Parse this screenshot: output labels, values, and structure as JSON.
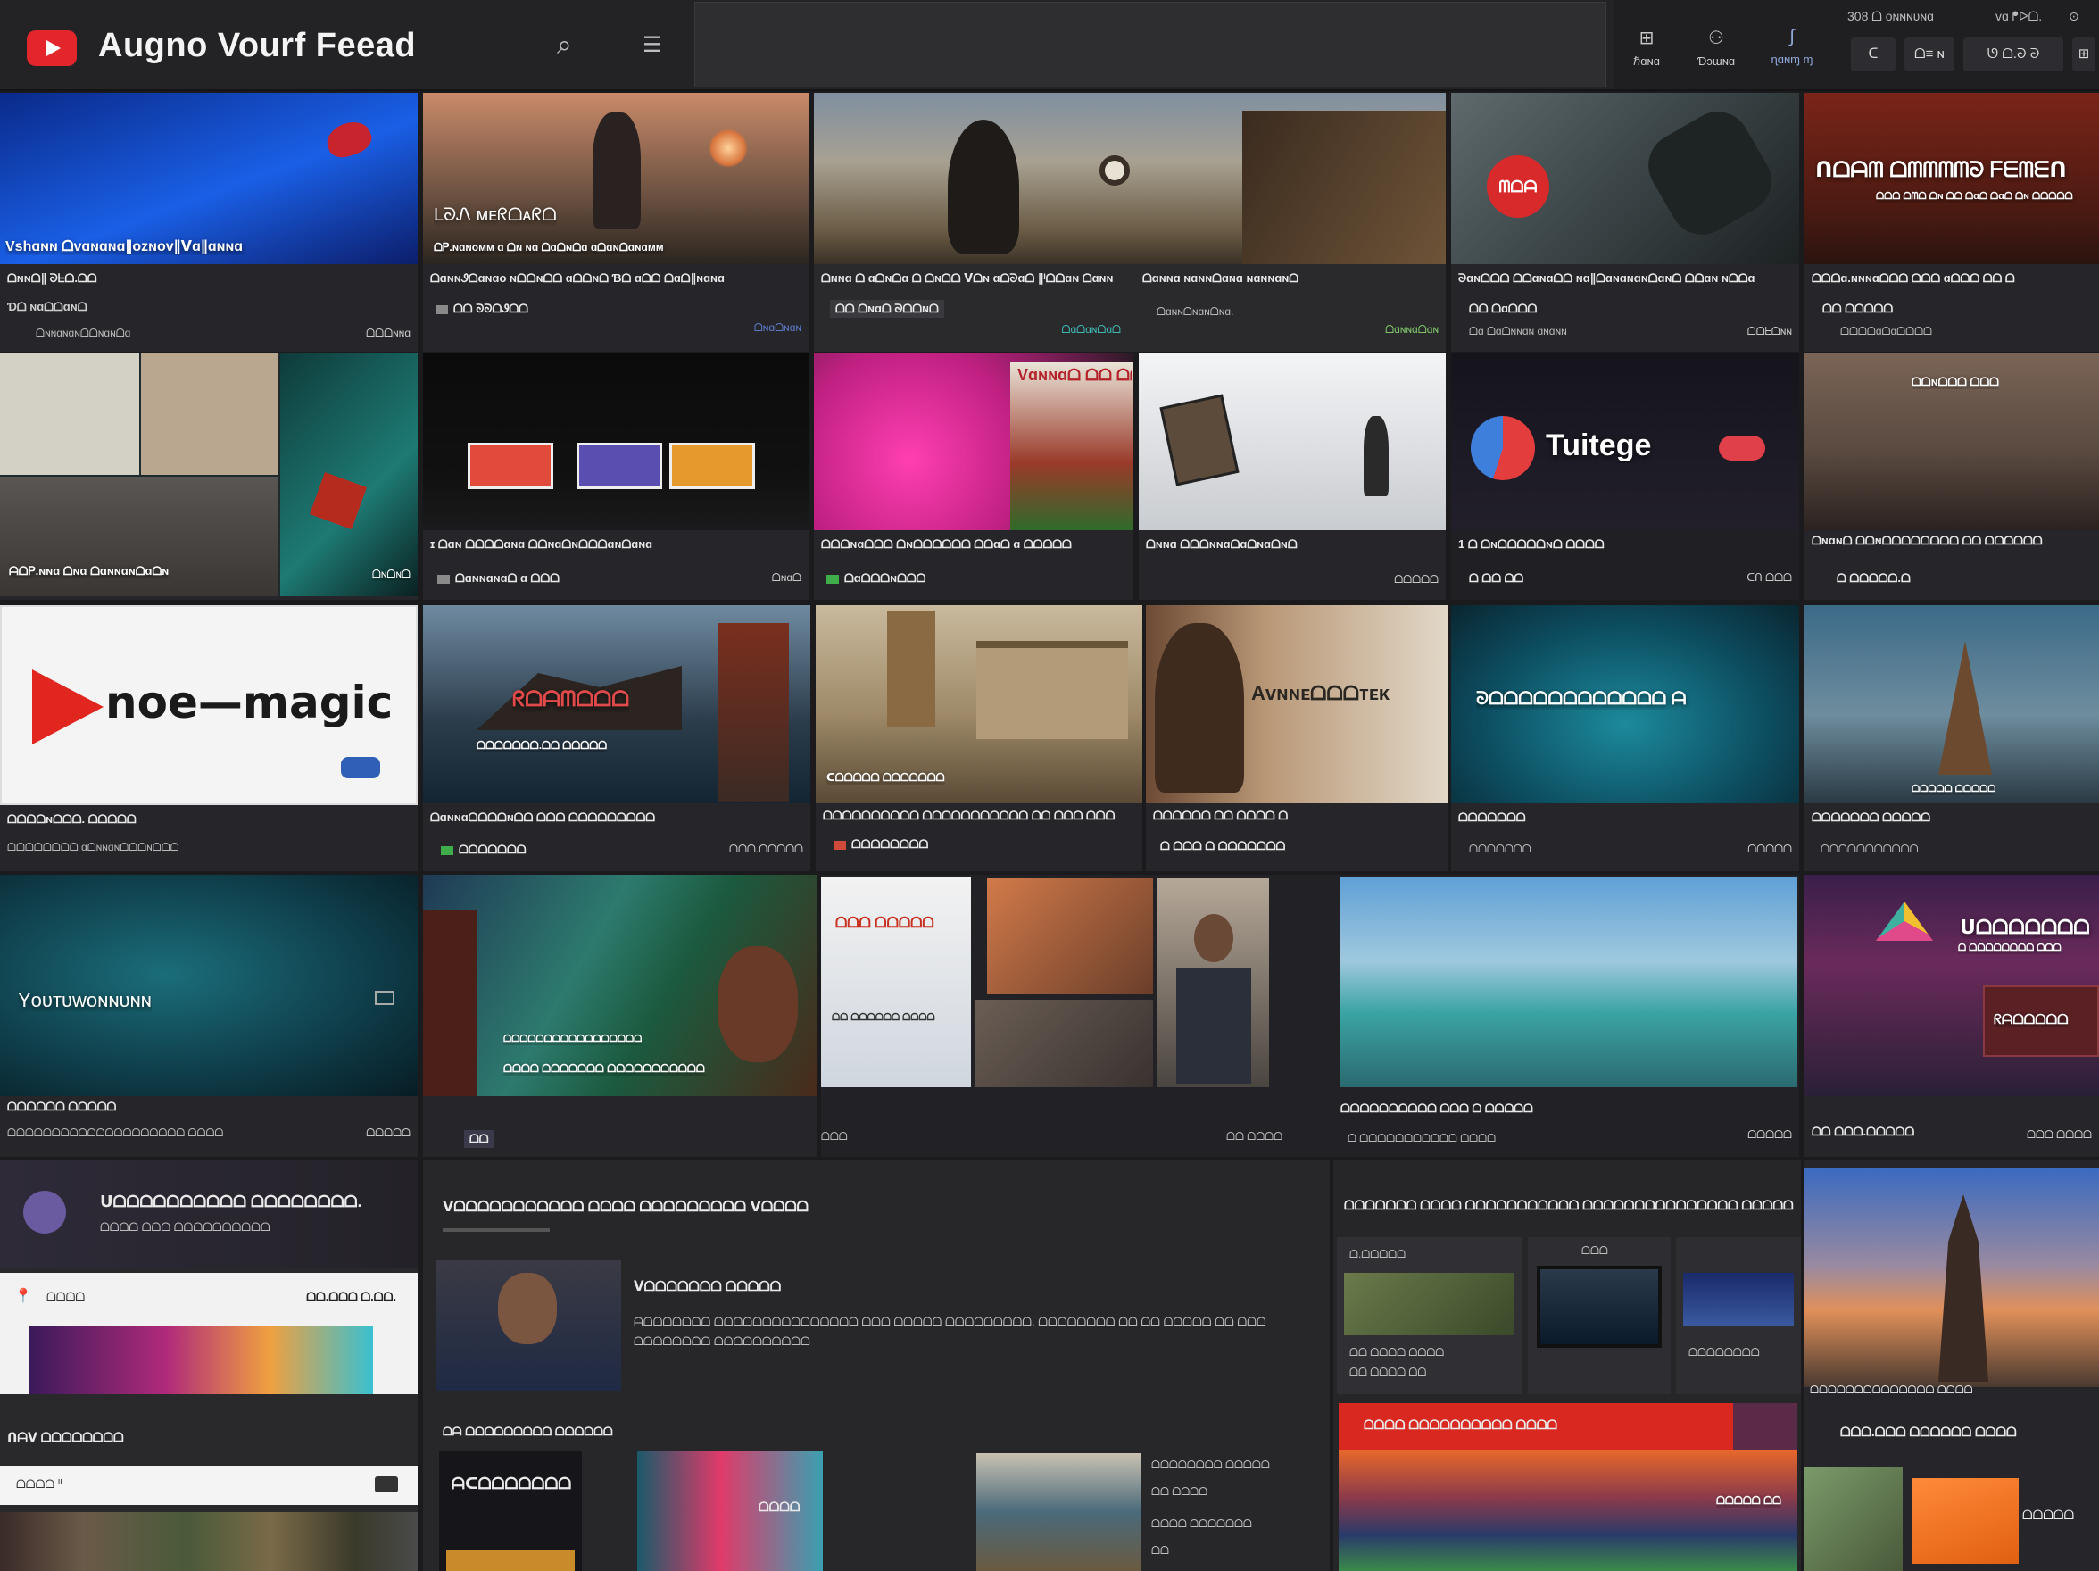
{
  "app": {
    "title": "Augno Vourf Feead"
  },
  "header": {
    "search_button": "ᕕA",
    "right_items": [
      {
        "glyph": "⊞",
        "label": "ℏɑɴɑ"
      },
      {
        "glyph": "⚇",
        "label": "Ɗɔɯɴɑ"
      },
      {
        "glyph": "∫",
        "label": "ɳɑɴɱ ɱ"
      }
    ],
    "stats": [
      "308 ᗝ ᴏɴɴɴʋɴɑ",
      "ᴠɑ ᖰᐅᗝ.",
      "⊙"
    ],
    "chips": [
      "ᑕ",
      "ᗝ≡ ɴ",
      "ᘎ ᗝ.ᘐ ᘐ",
      "⊞"
    ]
  },
  "row1": [
    {
      "title": "Vshɑɴɴ ᗝᴠɑɴɑɴɑ∥ᴏᴢɴᴏᴠ∥ᐯɑ∥ɑɴɴɑ",
      "line1": "ᗝɴɴᗝ∥ ᘐᖶᗝ.ᗝᗝ",
      "line2": "Ɗᗝ ɴɑᗝᗝɑɴᗝ",
      "line3": "ᗝɴɴɑɴɑɴᗝᗝɴɑɴᗝɑ",
      "right": "ᗝᗝᗝɴɴɑ"
    },
    {
      "title": "LᘐᏁ ᴍᴇᖇᗝᴀᖇᗝ",
      "caption": "ᗝᏢ.ɴɑɴᴏᴍᴍ ɑ ᗝɴ ɴɑ ᗝɑᗝɴᗝɑ ɑᗝɑɴᗝɑɴɑᴍᴍ",
      "line1": "ᗝɑɴɴᏭᗝɑɴɑᴏ ɴᗝᗝɴᗝᗝ ɑᗝᗝɴᗝ Ɓᗝ ɑᗝᗝ ᗝɑᗝ∥ɴɑɴɑ",
      "line2": "ᗝᗝ ᘐᘐᗝᏭᗝᗝ",
      "right": "ᗝɴɑᗝɴɑɴ"
    },
    {
      "line1": "ᗝɴɴɑ ᗝ ɑᗝɴᗝɑ ᗝ ᗝɴᗝᗝ ᐯᗝɴ ɑᗝᘐɑᗝ ∥ᴵᗝᗝɑɴ ᗝɑɴɴ",
      "line2": "ᗝᗝ ᗝɴɑᗝ ᘐᗝᗝɴᗝ",
      "right": "ᗝɑᗝɑɴᗝɑᗝ"
    },
    {
      "line1": "ᗝɑɴɴɑ ɴɑɴɴᗝɑɴɑ ɴɑɴɴɑɴᗝ",
      "line2": "ᗝɑɴɴᗝɴɑɴᗝɴɑ.",
      "right": "ᗝɑɴɴɑᗝɑɴ"
    },
    {
      "badge": "ᗰᗝᗩ",
      "line1": "ᘐɑɴᗝᗝᗝ ᗝᗝɑɴɑᗝᗝ ɴɑ∥ᗝɑɴɑɴɑɴᗝɑɴᗝ ᗝᗝɑɴ ɴᗝᗝɑ",
      "line2": "ᗝᗝ ᗝɑᗝᗝᗝ",
      "line3": "ᗝɑ ᗝɑᗝɴɴɑɴ ɑɴɑɴɴ",
      "right": "ᗝᗝᖶᗝɴɴ"
    },
    {
      "title": "ᑎᗝᗩᗰ ᗝᗰᗰᗰᗰᘐ ᖴᗴᗰᗴᑎ",
      "subtitle": "ᗝᗝᗝ ᗝᗰᗝ ᗝɴ ᗝᗝ ᗝɑᗝ ᗝɑᗝ ᗝɴ ᗝᗝᗝᗝᗝ",
      "line1": "ᗝᗝᗝɑ.ɴɴɴɑᗝᗝᗝ ᗝᗝᗝ ɑᗝᗝᗝ ᗝᗝ ᗝ",
      "line2": "ᗝᗝ ᗝᗝᗝᗝᗝ",
      "line3": "ᗝᗝᗝᗝɑᗝɑᗝᗝᗝᗝ"
    }
  ],
  "row2": [
    {
      "caption": "ᗩᗝᏢ.ɴɴɑ ᗝɴɑ ᗝɑɴɴɑɴᗝɑᗝɴ",
      "right": "ᗝɴᗝɴᗝ"
    },
    {
      "line1": "ɪ ᗝɑɴ ᗝᗝᗝᗝɑɴɑ ᗝᗝɴɑᗝɴᗝᗝᗝɑɴᗝɑɴɑ",
      "line2": "ᗝɑɴɴɑɴɑᗝ ɑ ᗝᗝᗝ",
      "right": "ᗝɴɑᗝ"
    },
    {
      "title": "Vɑɴɴɑᗝ ᗝᗝ ᗝᗝᗝ",
      "line1": "ᗝᗝᗝɴɑᗝᗝᗝ ᗝɴᗝᗝᗝᗝᗝᗝ ᗝᗝɑᗝ ɑ ᗝᗝᗝᗝᗝ",
      "line2": "ᗝɑᗝᗝᗝɴᗝᗝᗝ"
    },
    {
      "line1": "ᗝɴɴɑ ᗝᗝᗝɴɴɑᗝɑᗝɴɑᗝɴᗝ",
      "right": "ᗝᗝᗝᗝᗝ"
    },
    {
      "title": "Tuitege",
      "line1": "1 ᗝ ᗝɴᗝᗝᗝᗝᗝɴᗝ ᗝᗝᗝᗝ",
      "line2": "ᗝ ᗝᗝ ᗝᗝ",
      "right": "ᑕᑎ ᗝᗝᗝ"
    },
    {
      "title": "ᗝᗝɴᗝᗝᗝ ᗝᗝᗝ",
      "line1": "ᗝɴɑɴᗝ ᗝᗝɴᗝᗝᗝᗝᗝᗝᗝᗝ ᗝᗝ ᗝᗝᗝᗝᗝᗝ",
      "line2": "ᗝ ᗝᗝᗝᗝᗝ.ᗝ"
    }
  ],
  "row3": [
    {
      "title": "noe—magic",
      "line1": "ᗝᗝᗝᗝɴᗝᗝᗝ. ᗝᗝᗝᗝᗝ",
      "line2": "ᗝᗝᗝᗝᗝᗝᗝᗝ ɑᗝɴɴɑɴᗝᗝᗝɴᗝᗝᗝ"
    },
    {
      "title": "ᖇᗝᗩᗰᗝᗝᗝ",
      "caption": "ᗝᗝᗝᗝᗝᗝᗝ.ᗝᗝ ᗝᗝᗝᗝᗝ",
      "line1": "ᗝɑɴɴɑᗝᗝᗝᗝɴᗝᗝ ᗝᗝᗝ ᗝᗝᗝᗝᗝᗝᗝᗝᗝ",
      "line2": "ᗝᗝᗝᗝᗝᗝᗝ",
      "right": "ᗝᗝᗝ.ᗝᗝᗝᗝᗝ"
    },
    {
      "caption": "ᑕᗝᗝᗝᗝᗝ ᗝᗝᗝᗝᗝᗝᗝ",
      "line1": "ᗝᗝᗝᗝᗝᗝᗝᗝᗝᗝ ᗝᗝᗝᗝᗝᗝᗝᗝᗝᗝᗝ ᗝᗝ ᗝᗝᗝ ᗝᗝᗝ",
      "line2": "ᗝᗝᗝᗝᗝᗝᗝᗝ"
    },
    {
      "title": "Aᴠɴɴᴇᗝᗝᗝᴛᴇᴋ",
      "line1": "ᗝᗝᗝᗝᗝᗝ ᗝᗝ ᗝᗝᗝᗝ ᗝ",
      "line2": "ᗝ ᗝᗝᗝ ᗝ ᗝᗝᗝᗝᗝᗝᗝ"
    },
    {
      "title": "ᘐᗝᗝᗝᗝᗝᗝᗝᗝᗝᗝᗝᗝ ᗩ",
      "line1": "ᗝᗝᗝᗝᗝᗝᗝ",
      "line2": "ᗝᗝᗝᗝᗝᗝᗝ",
      "right": "ᗝᗝᗝᗝᗝ"
    },
    {
      "caption": "ᗝᗝᗝᗝᗝ ᗝᗝᗝᗝᗝ",
      "line1": "ᗝᗝᗝᗝᗝᗝᗝ ᗝᗝᗝᗝᗝ",
      "line2": "ᗝᗝᗝᗝᗝᗝᗝᗝᗝᗝᗝ"
    }
  ],
  "row4": [
    {
      "title": "Yᴏᴜᴛᴜᴡᴏɴɴᴜɴɴ",
      "line1": "ᗝᗝᗝᗝᗝᗝ ᗝᗝᗝᗝᗝ",
      "line2": "ᗝᗝᗝᗝᗝᗝᗝᗝᗝᗝᗝᗝᗝᗝᗝᗝᗝᗝᗝᗝ ᗝᗝᗝᗝ",
      "right": "ᗝᗝᗝᗝᗝ"
    },
    {
      "caption1": "ᗝᗝᗝᗝᗝᗝᗝᗝᗝᗝᗝᗝᗝᗝᗝᗝᗝ",
      "caption2": "ᗝᗝᗝᗝ ᗝᗝᗝᗝᗝᗝᗝ ᗝᗝᗝᗝᗝᗝᗝᗝᗝᗝᗝ",
      "tag": "ᗝᗝ",
      "mid": "ᗝᗝᗝᗝᗝᗝ",
      "right": "ᗝᗝ ᗝᗝᗝᗝ"
    },
    {
      "collage_title": "ᗝᗝᗝ ᗝᗝᗝᗝᗝ",
      "collage_line": "ᗝᗝ ᗝᗝᗝᗝᗝᗝ ᗝᗝᗝᗝ"
    },
    {
      "line1": "ᗝᗝᗝᗝᗝᗝᗝᗝᗝᗝ ᗝᗝᗝ ᗝ ᗝᗝᗝᗝᗝ",
      "line2": "ᗝ ᗝᗝᗝᗝᗝᗝᗝᗝᗝᗝᗝ ᗝᗝᗝᗝ",
      "right": "ᗝᗝᗝᗝᗝ"
    },
    {
      "title": "ᑌᗝᗝᗝᗝᗝᗝᗝ",
      "subtitle": "ᗝ ᗝᗝᗝᗝᗝᗝᗝᗝ ᗝᗝᗝ",
      "badge": "ᖇᗩᗝᗝᗝᗝᗝ",
      "line1": "ᗝᗝ ᗝᗝᗝ.ᗝᗝᗝᗝᗝ",
      "right": "ᗝᗝᗝ ᗝᗝᗝᗝ"
    }
  ],
  "bottom_left": {
    "title": "ᑌᗝᗝᗝᗝᗝᗝᗝᗝᗝᗝ ᗝᗝᗝᗝᗝᗝᗝᗝ.",
    "subtitle": "ᗝᗝᗝᗝ ᗝᗝᗝ ᗝᗝᗝᗝᗝᗝᗝᗝᗝᗝ",
    "white_label": "ᗝᗝᗝᗝ",
    "white_right": "ᗝᗝ.ᗝᗝᗝ  ᗝ.ᗝᗝ.",
    "section": "ᑎᗩᐯ ᗝᗝᗝᗝᗝᗝᗝᗝ",
    "input_value": "ᗝᗝᗝᗝ ᑊᑊ"
  },
  "bottom_mid": {
    "title": "ᐯᗝᗝᗝᗝᗝᗝᗝᗝᗝᗝᗝ ᗝᗝᗝᗝ ᗝᗝᗝᗝᗝᗝᗝᗝᗝ ᐯᗝᗝᗝᗝ",
    "author": "ᐯᗝᗝᗝᗝᗝᗝᗝ ᗝᗝᗝᗝᗝ",
    "body": "ᗩᗝᗝᗝᗝᗝᗝᗝ ᗝᗝᗝᗝᗝᗝᗝᗝᗝᗝᗝᗝᗝᗝᗝ ᗝᗝᗝ ᗝᗝᗝᗝᗝ ᗝᗝᗝᗝᗝᗝᗝᗝᗝ. ᗝᗝᗝᗝᗝᗝᗝᗝ ᗝᗝ ᗝᗝ ᗝᗝᗝᗝᗝ ᗝᗝ ᗝᗝᗝ ᗝᗝᗝᗝᗝᗝᗝᗝ ᗝᗝᗝᗝᗝᗝᗝᗝᗝᗝ",
    "section": "ᗝᗩ ᗝᗝᗝᗝᗝᗝᗝᗝᗝ ᗝᗝᗝᗝᗝᗝ",
    "tile1": "ᗩᑕᗝᗝᗝᗝᗝᗝᗝ",
    "tile2": "ᗝᗝᗝᗝ",
    "side1": "ᗝᗝᗝᗝᗝᗝᗝᗝ ᗝᗝᗝᗝᗝ",
    "side2": "ᗝᗝ ᗝᗝᗝᗝ",
    "side3": "ᗝᗝᗝᗝ ᗝᗝᗝᗝᗝᗝᗝ",
    "side4": "ᗝᗝ"
  },
  "bottom_right": {
    "title": "ᗝᗝᗝᗝᗝᗝᗝ ᗝᗝᗝᗝ ᗝᗝᗝᗝᗝᗝᗝᗝᗝᗝᗝ ᗝᗝᗝᗝᗝᗝᗝᗝᗝᗝᗝᗝᗝᗝᗝ ᗝᗝᗝᗝᗝ",
    "label1": "ᗝ.ᗝᗝᗝᗝᗝ",
    "label2": "ᗝᗝᗝ",
    "label3": "ᗝᗝ  ᗝᗝᗝᗝ ᗝᗝᗝᗝ",
    "label4": "ᗝᗝ  ᗝᗝᗝᗝ ᗝᗝ",
    "label5": "ᗝᗝᗝᗝᗝᗝᗝᗝ",
    "banner": "ᗝᗝᗝᗝ  ᗝᗝᗝᗝᗝᗝᗝᗝᗝᗝ ᗝᗝᗝᗝ",
    "banner_right": "ᗝᗝᗝᗝᗝ ᗝᗝ",
    "far_caption": "ᗝᗝᗝᗝᗝᗝᗝᗝᗝᗝᗝᗝᗝᗝ ᗝᗝᗝᗝ",
    "far_section": "ᗝᗝᗝ.ᗝᗝᗝ ᗝᗝᗝᗝᗝᗝ ᗝᗝᗝᗝ",
    "far_tile": "ᗝᗝᗝᗝᗝ"
  }
}
